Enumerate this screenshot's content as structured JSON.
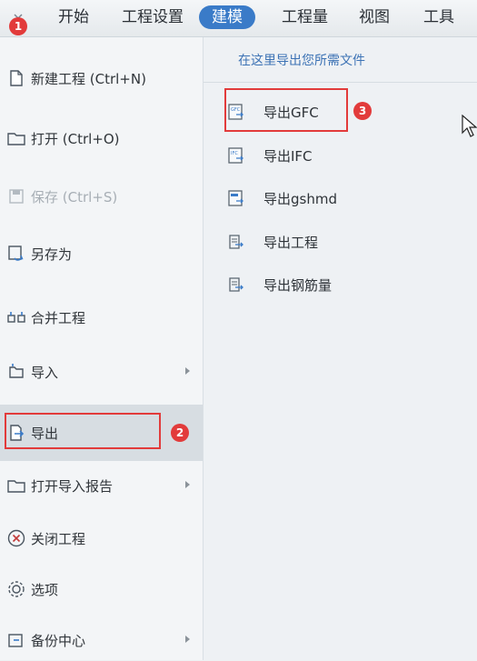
{
  "ribbon": {
    "tabs": [
      {
        "label": "开始"
      },
      {
        "label": "工程设置"
      },
      {
        "label": "建模"
      },
      {
        "label": "工程量"
      },
      {
        "label": "视图"
      },
      {
        "label": "工具"
      }
    ],
    "active_tab": "建模"
  },
  "left_menu": {
    "items": [
      {
        "label": "新建工程 (Ctrl+N)",
        "icon": "new-file-icon"
      },
      {
        "label": "打开 (Ctrl+O)",
        "icon": "folder-icon"
      },
      {
        "label": "保存 (Ctrl+S)",
        "icon": "save-icon",
        "state": "disabled"
      },
      {
        "label": "另存为",
        "icon": "save-as-icon"
      },
      {
        "label": "合并工程",
        "icon": "merge-icon"
      },
      {
        "label": "导入",
        "icon": "import-icon",
        "has_submenu": true
      },
      {
        "label": "导出",
        "icon": "export-icon",
        "state": "selected"
      },
      {
        "label": "打开导入报告",
        "icon": "folder-icon",
        "has_submenu": true
      },
      {
        "label": "关闭工程",
        "icon": "close-circle-icon"
      },
      {
        "label": "选项",
        "icon": "gear-icon"
      },
      {
        "label": "备份中心",
        "icon": "backup-icon",
        "has_submenu": true
      }
    ]
  },
  "export_panel": {
    "header": "在这里导出您所需文件",
    "items": [
      {
        "label": "导出GFC",
        "icon": "gfc-file-icon"
      },
      {
        "label": "导出IFC",
        "icon": "ifc-file-icon"
      },
      {
        "label": "导出gshmd",
        "icon": "gshmd-file-icon"
      },
      {
        "label": "导出工程",
        "icon": "export-project-icon"
      },
      {
        "label": "导出钢筋量",
        "icon": "export-rebar-icon"
      }
    ]
  },
  "annotations": {
    "badges": [
      "1",
      "2",
      "3"
    ],
    "highlight_color": "#e23b3b"
  },
  "colors": {
    "accent": "#3a7bc8",
    "link": "#3d73b5"
  }
}
